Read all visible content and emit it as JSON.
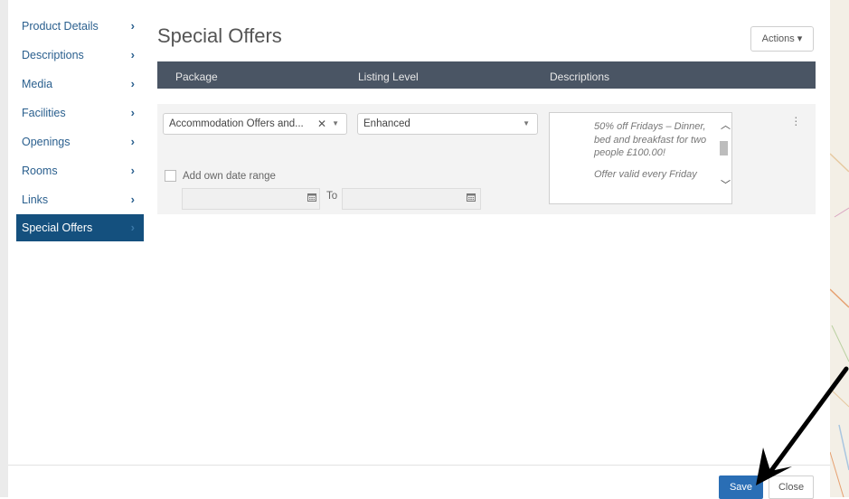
{
  "sidebar": {
    "items": [
      {
        "label": "Product Details",
        "chev": "›"
      },
      {
        "label": "Descriptions",
        "chev": "›"
      },
      {
        "label": "Media",
        "chev": "›"
      },
      {
        "label": "Facilities",
        "chev": "›"
      },
      {
        "label": "Openings",
        "chev": "›"
      },
      {
        "label": "Rooms",
        "chev": "›"
      },
      {
        "label": "Links",
        "chev": "›"
      },
      {
        "label": "Special Offers",
        "chev": "›"
      }
    ],
    "active": "Special Offers"
  },
  "page_title": "Special Offers",
  "actions_label": "Actions ▾",
  "table": {
    "headers": [
      "Package",
      "Listing Level",
      "Descriptions"
    ]
  },
  "row": {
    "package_value": "Accommodation Offers and...",
    "package_clear": "✕",
    "listing_level_value": "Enhanced",
    "add_own_date_range_label": "Add own date range",
    "add_own_date_range_checked": false,
    "date_to_label": "To",
    "from_date_value": "",
    "to_date_value": "",
    "description_lines": [
      "50% off Fridays – Dinner, bed and breakfast for two people £100.00!",
      "Offer valid every Friday"
    ]
  },
  "footer": {
    "save_label": "Save",
    "close_label": "Close"
  },
  "colors": {
    "sidebar_active_bg": "#14507e",
    "table_header_bg": "#4a5564",
    "save_button_bg": "#2a6eb5",
    "annotation_arrow": "#000000"
  },
  "icons": [
    "chevron-right-icon",
    "caret-down-icon",
    "clear-icon",
    "calendar-icon",
    "scroll-up-icon",
    "scroll-down-icon",
    "kebab-menu-icon",
    "annotation-arrow"
  ]
}
